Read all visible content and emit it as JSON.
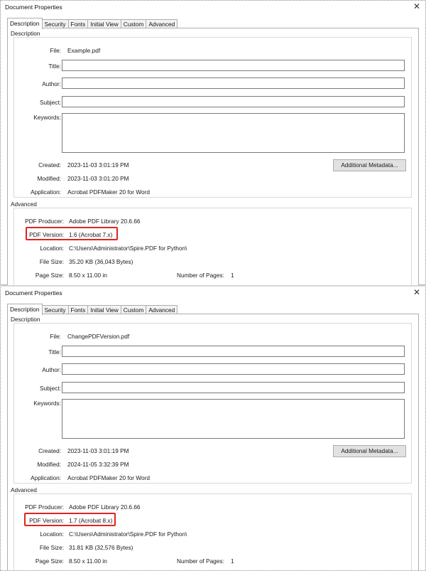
{
  "dialogs": [
    {
      "title": "Document Properties",
      "close_glyph": "✕",
      "tabs": [
        "Description",
        "Security",
        "Fonts",
        "Initial View",
        "Custom",
        "Advanced"
      ],
      "description": {
        "group_label": "Description",
        "file_label": "File:",
        "file": "Example.pdf",
        "title_label": "Title:",
        "author_label": "Author:",
        "subject_label": "Subject:",
        "keywords_label": "Keywords:",
        "title_value": "",
        "author_value": "",
        "subject_value": "",
        "keywords_value": "",
        "created_label": "Created:",
        "created": "2023-11-03 3:01:19 PM",
        "modified_label": "Modified:",
        "modified": "2023-11-03 3:01:20 PM",
        "application_label": "Application:",
        "application": "Acrobat PDFMaker 20 for Word",
        "metadata_button": "Additional Metadata..."
      },
      "advanced": {
        "group_label": "Advanced",
        "producer_label": "PDF Producer:",
        "producer": "Adobe PDF Library 20.6.66",
        "version_label": "PDF Version:",
        "version": "1.6 (Acrobat 7.x)",
        "location_label": "Location:",
        "location": "C:\\Users\\Administrator\\Spire.PDF for Python\\",
        "filesize_label": "File Size:",
        "filesize": "35.20 KB (36,043 Bytes)",
        "pagesize_label": "Page Size:",
        "pagesize": "8.50 x 11.00 in",
        "numpages_label": "Number of Pages:",
        "numpages": "1"
      }
    },
    {
      "title": "Document Properties",
      "close_glyph": "✕",
      "tabs": [
        "Description",
        "Security",
        "Fonts",
        "Initial View",
        "Custom",
        "Advanced"
      ],
      "description": {
        "group_label": "Description",
        "file_label": "File:",
        "file": "ChangePDFVersion.pdf",
        "title_label": "Title:",
        "author_label": "Author:",
        "subject_label": "Subject:",
        "keywords_label": "Keywords:",
        "title_value": "",
        "author_value": "",
        "subject_value": "",
        "keywords_value": "",
        "created_label": "Created:",
        "created": "2023-11-03 3:01:19 PM",
        "modified_label": "Modified:",
        "modified": "2024-11-05 3:32:39 PM",
        "application_label": "Application:",
        "application": "Acrobat PDFMaker 20 for Word",
        "metadata_button": "Additional Metadata..."
      },
      "advanced": {
        "group_label": "Advanced",
        "producer_label": "PDF Producer:",
        "producer": "Adobe PDF Library 20.6.66",
        "version_label": "PDF Version:",
        "version": "1.7 (Acrobat 8.x)",
        "location_label": "Location:",
        "location": "C:\\Users\\Administrator\\Spire.PDF for Python\\",
        "filesize_label": "File Size:",
        "filesize": "31.81 KB (32,576 Bytes)",
        "pagesize_label": "Page Size:",
        "pagesize": "8.50 x 11.00 in",
        "numpages_label": "Number of Pages:",
        "numpages": "1"
      }
    }
  ],
  "highlight_color": "#e1241e"
}
